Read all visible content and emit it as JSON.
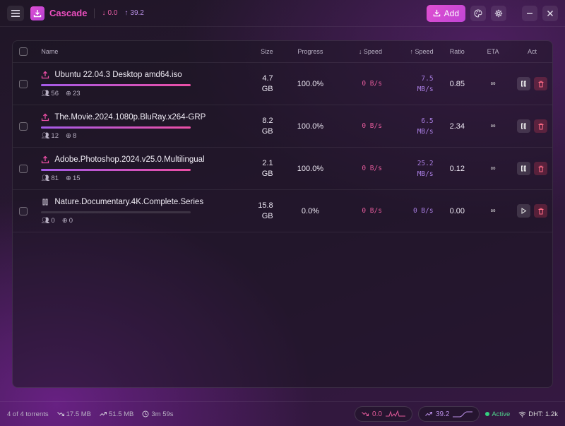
{
  "app": {
    "title": "Cascade",
    "header_down": "0.0",
    "header_up": "39.2",
    "add_label": "Add"
  },
  "colors": {
    "accent": "#e04fd0",
    "download": "#e25a9a",
    "upload": "#a77ce0",
    "active": "#35d07f"
  },
  "table": {
    "columns": {
      "name": "Name",
      "size": "Size",
      "progress": "Progress",
      "down": "↓ Speed",
      "up": "↑ Speed",
      "ratio": "Ratio",
      "eta": "ETA",
      "act": "Act"
    },
    "rows": [
      {
        "status_icon": "upload-icon",
        "name": "Ubuntu 22.04.3 Desktop amd64.iso",
        "progress": 1.0,
        "peers": "56",
        "seeds": "23",
        "size_value": "4.7",
        "size_unit": "GB",
        "progress_text": "100.0%",
        "down_speed": "0 B/s",
        "up_value": "7.5",
        "up_unit": "MB/s",
        "ratio": "0.85",
        "eta": "∞",
        "action": "pause"
      },
      {
        "status_icon": "upload-icon",
        "name": "The.Movie.2024.1080p.BluRay.x264-GRP",
        "progress": 1.0,
        "peers": "12",
        "seeds": "8",
        "size_value": "8.2",
        "size_unit": "GB",
        "progress_text": "100.0%",
        "down_speed": "0 B/s",
        "up_value": "6.5",
        "up_unit": "MB/s",
        "ratio": "2.34",
        "eta": "∞",
        "action": "pause"
      },
      {
        "status_icon": "upload-icon",
        "name": "Adobe.Photoshop.2024.v25.0.Multilingual",
        "progress": 1.0,
        "peers": "81",
        "seeds": "15",
        "size_value": "2.1",
        "size_unit": "GB",
        "progress_text": "100.0%",
        "down_speed": "0 B/s",
        "up_value": "25.2",
        "up_unit": "MB/s",
        "ratio": "0.12",
        "eta": "∞",
        "action": "pause"
      },
      {
        "status_icon": "paused-icon",
        "name": "Nature.Documentary.4K.Complete.Series",
        "progress": 0.0,
        "peers": "0",
        "seeds": "0",
        "size_value": "15.8",
        "size_unit": "GB",
        "progress_text": "0.0%",
        "down_speed": "0 B/s",
        "up_value": "0 B/s",
        "up_unit": "",
        "ratio": "0.00",
        "eta": "∞",
        "action": "play"
      }
    ]
  },
  "footer": {
    "count": "4 of 4 torrents",
    "downloaded": "17.5 MB",
    "uploaded": "51.5 MB",
    "elapsed": "3m 59s",
    "down_rate": "0.0",
    "up_rate": "39.2",
    "status": "Active",
    "dht": "DHT: 1.2k"
  }
}
